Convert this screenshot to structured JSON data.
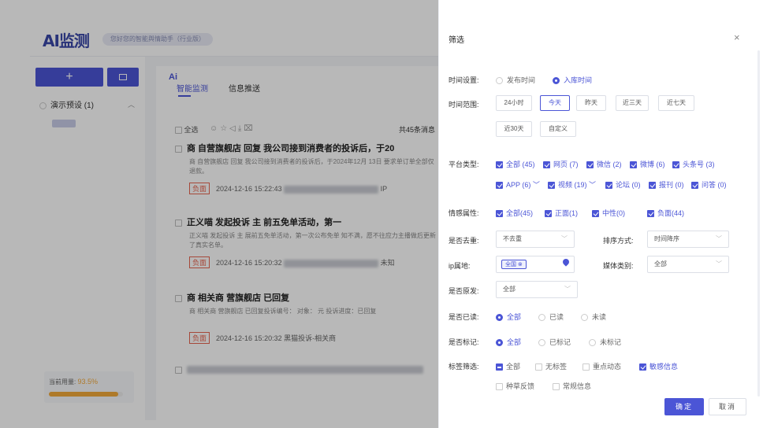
{
  "app": {
    "logo": "AI监测",
    "slogan": "您好您的智能舆情助手（行业版）",
    "add_label": "+",
    "group": "演示预设 (1)",
    "usage_label": "当前用量:",
    "usage_value": "93.5%",
    "usage_fraction": 0.935
  },
  "main": {
    "tab_ai_mark": "Ai",
    "tab1": "智能监测",
    "tab2": "信息推送",
    "select_all": "全选",
    "tool_icons": "☺☆◁⤓⌧",
    "count": "共45条消息",
    "articles": [
      {
        "title": "商  自营旗舰店 回复 我公司接到消费者的投诉后，于20",
        "body": "商  自营旗舰店 回复 我公司接到消费者的投诉后，于2024年12月 13日 要求单订单全部仅退款。",
        "tag": "负面",
        "time": "2024-12-16 15:22:43",
        "source": "IP"
      },
      {
        "title": "正义喵 发起投诉 主    前五免单活动，第一",
        "body": "正义喵 发起投诉 主    展前五免单活动，第一次公布免单 知不满，愿不往应力主播做后更新了真实名单。",
        "tag": "负面",
        "time": "2024-12-16 15:20:32",
        "source": "未知"
      },
      {
        "title": "商 相关商    营旗舰店 已回复",
        "body": "商 相关商    营旗舰店 已回复投诉编号：    对象： 元 投诉进度：已回复",
        "tag": "负面",
        "time": "2024-12-16 15:20:32",
        "source": "黑猫投诉-相关商"
      }
    ]
  },
  "filter": {
    "title": "筛选",
    "time_setting_label": "时间设置:",
    "time_setting_options": [
      "发布时间",
      "入库时间"
    ],
    "time_range_label": "时间范围:",
    "time_range_options": [
      "24小时",
      "今天",
      "昨天",
      "近三天",
      "近七天",
      "近30天",
      "自定义"
    ],
    "platform_label": "平台类型:",
    "platform_options": [
      "全部 (45)",
      "网页 (7)",
      "微信 (2)",
      "微博 (6)",
      "头条号 (3)",
      "APP (6)",
      "视频 (19)",
      "论坛 (0)",
      "报刊 (0)",
      "问答 (0)"
    ],
    "sentiment_label": "情感属性:",
    "sentiment_options": [
      "全部(45)",
      "正面(1)",
      "中性(0)",
      "负面(44)"
    ],
    "dedupe_label": "是否去重:",
    "dedupe_value": "不去重",
    "sort_label": "排序方式:",
    "sort_value": "时间降序",
    "ip_label": "ip属地:",
    "ip_tag": "全国",
    "media_label": "媒体类别:",
    "media_value": "全部",
    "original_label": "是否原发:",
    "original_value": "全部",
    "read_label": "是否已读:",
    "read_options": [
      "全部",
      "已读",
      "未读"
    ],
    "marked_label": "是否标记:",
    "marked_options": [
      "全部",
      "已标记",
      "未标记"
    ],
    "tag_label": "标签筛选:",
    "tag_options": [
      "全部",
      "无标签",
      "重点动态",
      "敏感信息",
      "种草反馈",
      "常规信息"
    ],
    "ok_label": "确定",
    "cancel_label": "取消",
    "close_icon": "×"
  }
}
